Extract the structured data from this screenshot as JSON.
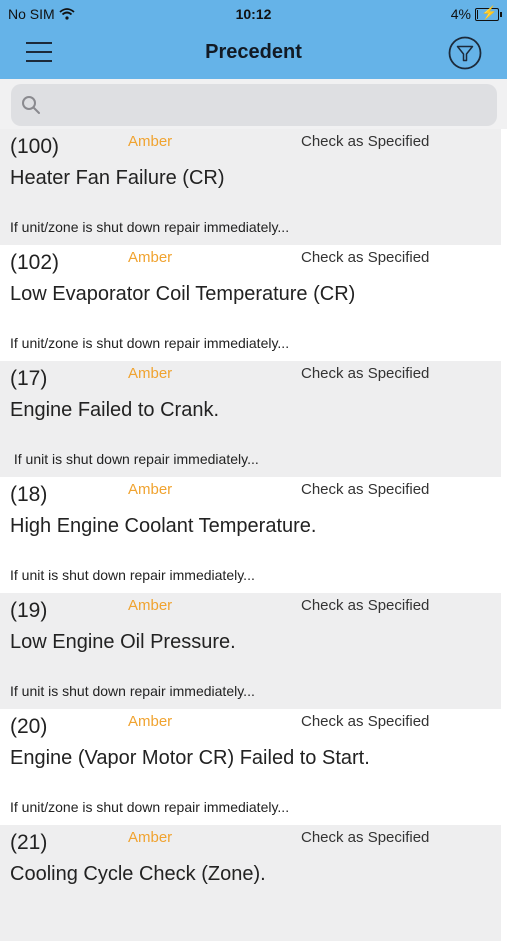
{
  "status": {
    "carrier": "No SIM",
    "time": "10:12",
    "battery": "4%"
  },
  "header": {
    "title": "Precedent"
  },
  "search": {
    "placeholder": ""
  },
  "colors": {
    "header": "#65b3e8",
    "severity": "#f0a330"
  },
  "items": [
    {
      "code": "(100)",
      "severity": "Amber",
      "action": "Check as Specified",
      "name": "Heater Fan Failure (CR)",
      "note": "If unit/zone is shut down repair immediately..."
    },
    {
      "code": "(102)",
      "severity": "Amber",
      "action": "Check as Specified",
      "name": "Low Evaporator Coil Temperature (CR)",
      "note": "If unit/zone is shut down repair immediately..."
    },
    {
      "code": "(17)",
      "severity": "Amber",
      "action": "Check as Specified",
      "name": "Engine Failed to Crank.",
      "note": " If unit is shut down repair immediately..."
    },
    {
      "code": "(18)",
      "severity": "Amber",
      "action": "Check as Specified",
      "name": "High Engine Coolant Temperature.",
      "note": "If unit is shut down repair immediately..."
    },
    {
      "code": "(19)",
      "severity": "Amber",
      "action": "Check as Specified",
      "name": "Low Engine Oil Pressure.",
      "note": "If unit is shut down repair immediately..."
    },
    {
      "code": "(20)",
      "severity": "Amber",
      "action": "Check as Specified",
      "name": "Engine (Vapor Motor CR) Failed to Start.",
      "note": "If unit/zone is shut down repair immediately..."
    },
    {
      "code": "(21)",
      "severity": "Amber",
      "action": "Check as Specified",
      "name": "Cooling Cycle Check (Zone).",
      "note": ""
    }
  ]
}
